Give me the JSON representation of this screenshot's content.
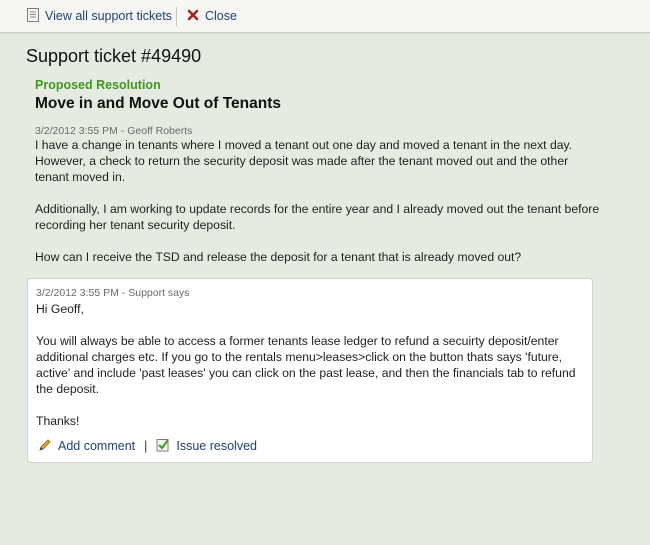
{
  "toolbar": {
    "view_all_label": "View all support tickets",
    "close_label": "Close",
    "icons": {
      "view_all": "document-icon",
      "close": "close-x-icon"
    }
  },
  "ticket": {
    "title": "Support ticket #49490",
    "status_label": "Proposed Resolution",
    "subject": "Move in and Move Out of Tenants",
    "question": {
      "meta": "3/2/2012 3:55 PM - Geoff Roberts",
      "paragraphs": [
        "I have a change in tenants where I moved a tenant out one day and moved a tenant in the next day. However, a check to return the security deposit was made after the tenant moved out and the other tenant moved in.",
        "Additionally, I am working to update records for the entire year and I already moved out the tenant before recording her tenant security deposit.",
        "How can I receive the TSD and release the deposit for a tenant that is already moved out?"
      ]
    },
    "reply": {
      "meta": "3/2/2012 3:55 PM - Support says",
      "paragraphs": [
        "Hi Geoff,",
        "You will always be able to access a former tenants lease ledger to refund a secuirty deposit/enter additional charges etc. If you go to the rentals menu>leases>click on the button thats says 'future, active' and include 'past leases' you can click on the past lease, and then the financials tab to refund the deposit.",
        "Thanks!"
      ],
      "add_comment_label": "Add comment",
      "separator": "|",
      "issue_resolved_label": "Issue resolved"
    }
  },
  "colors": {
    "page_bg": "#e6ebe2",
    "link": "#1f3f78",
    "status_green": "#3f9a1c"
  }
}
